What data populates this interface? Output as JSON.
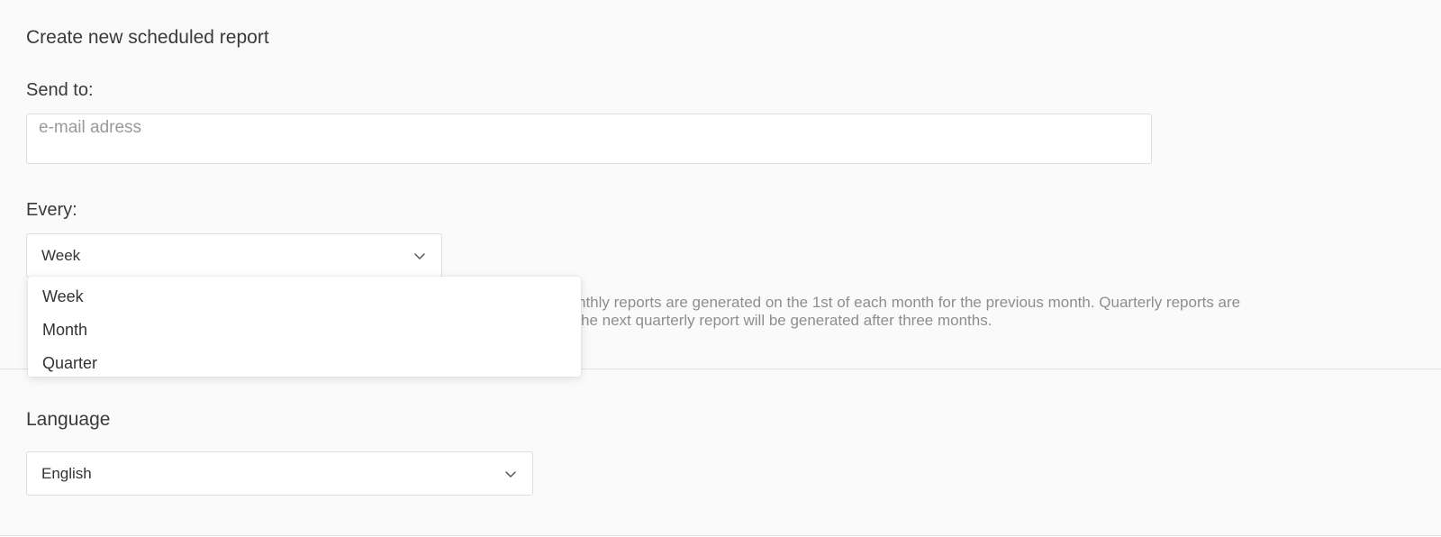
{
  "form": {
    "title": "Create new scheduled report",
    "send_to_label": "Send to:",
    "email_placeholder": "e-mail adress",
    "email_value": "",
    "every_label": "Every:",
    "every_selected": "Week",
    "every_options": [
      "Week",
      "Month",
      "Quarter"
    ],
    "help_text": "…nthly reports are generated on the 1st of each month for the previous month. Quarterly reports are …he next quarterly report will be generated after three months.",
    "help_line1": "nthly reports are generated on the 1st of each month for the previous month. Quarterly reports are",
    "help_line2": "he next quarterly report will be generated after three months."
  },
  "language": {
    "heading": "Language",
    "selected": "English"
  },
  "icons": {
    "every_chevron": "chevron-down-icon",
    "language_chevron": "chevron-down-icon"
  },
  "colors": {
    "background": "#fafafa",
    "border": "#dddddd",
    "help_text": "#8e8e8e"
  }
}
